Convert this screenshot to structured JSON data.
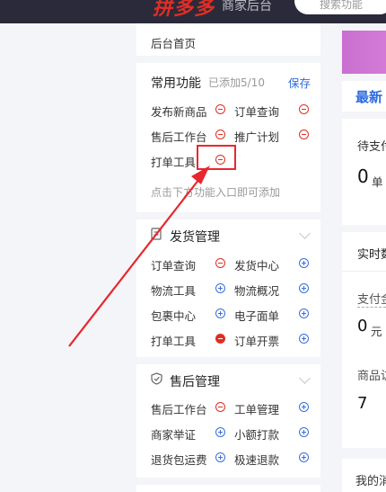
{
  "header": {
    "logo": "拼多多",
    "subtitle": "商家后台",
    "search_placeholder": "搜索功能"
  },
  "menu": {
    "home": "后台首页",
    "common": {
      "title": "常用功能",
      "count": "已添加5/10",
      "save": "保存",
      "items": [
        "发布新商品",
        "订单查询",
        "售后工作台",
        "推广计划",
        "打单工具"
      ],
      "hint": "点击下方功能入口即可添加"
    },
    "shipping": {
      "title": "发货管理",
      "items": [
        "订单查询",
        "发货中心",
        "物流工具",
        "物流概况",
        "包裹中心",
        "电子面单",
        "打单工具",
        "订单开票"
      ]
    },
    "aftersale": {
      "title": "售后管理",
      "items": [
        "售后工作台",
        "工单管理",
        "商家举证",
        "小额打款",
        "退货包运费",
        "极速退款"
      ]
    }
  },
  "right": {
    "latest": "最新",
    "pending_label": "待支付",
    "pending_value": "0",
    "pending_unit": "单",
    "realtime": "实时数",
    "pay_label": "支付金",
    "pay_value": "0",
    "pay_unit": "元",
    "goods_label": "商品访",
    "goods_value": "7",
    "mine": "我的消"
  },
  "colors": {
    "brand_red": "#e02e24",
    "link_blue": "#2b6ae0",
    "annotation": "#e8262f"
  }
}
